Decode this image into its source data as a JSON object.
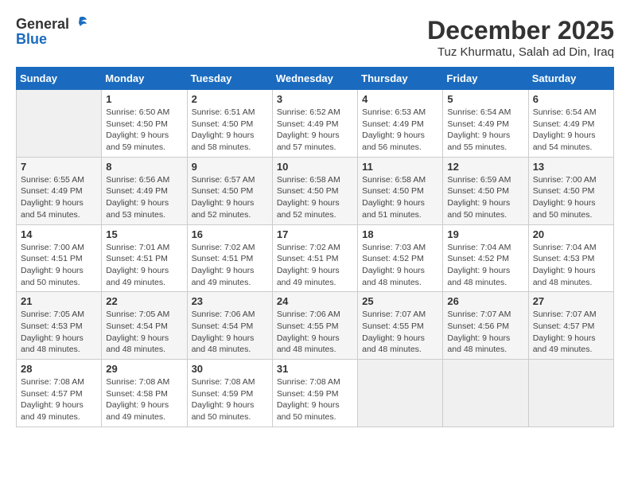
{
  "header": {
    "logo_general": "General",
    "logo_blue": "Blue",
    "month_title": "December 2025",
    "location": "Tuz Khurmatu, Salah ad Din, Iraq"
  },
  "days_of_week": [
    "Sunday",
    "Monday",
    "Tuesday",
    "Wednesday",
    "Thursday",
    "Friday",
    "Saturday"
  ],
  "weeks": [
    [
      {
        "day": "",
        "info": ""
      },
      {
        "day": "1",
        "info": "Sunrise: 6:50 AM\nSunset: 4:50 PM\nDaylight: 9 hours\nand 59 minutes."
      },
      {
        "day": "2",
        "info": "Sunrise: 6:51 AM\nSunset: 4:50 PM\nDaylight: 9 hours\nand 58 minutes."
      },
      {
        "day": "3",
        "info": "Sunrise: 6:52 AM\nSunset: 4:49 PM\nDaylight: 9 hours\nand 57 minutes."
      },
      {
        "day": "4",
        "info": "Sunrise: 6:53 AM\nSunset: 4:49 PM\nDaylight: 9 hours\nand 56 minutes."
      },
      {
        "day": "5",
        "info": "Sunrise: 6:54 AM\nSunset: 4:49 PM\nDaylight: 9 hours\nand 55 minutes."
      },
      {
        "day": "6",
        "info": "Sunrise: 6:54 AM\nSunset: 4:49 PM\nDaylight: 9 hours\nand 54 minutes."
      }
    ],
    [
      {
        "day": "7",
        "info": "Sunrise: 6:55 AM\nSunset: 4:49 PM\nDaylight: 9 hours\nand 54 minutes."
      },
      {
        "day": "8",
        "info": "Sunrise: 6:56 AM\nSunset: 4:49 PM\nDaylight: 9 hours\nand 53 minutes."
      },
      {
        "day": "9",
        "info": "Sunrise: 6:57 AM\nSunset: 4:50 PM\nDaylight: 9 hours\nand 52 minutes."
      },
      {
        "day": "10",
        "info": "Sunrise: 6:58 AM\nSunset: 4:50 PM\nDaylight: 9 hours\nand 52 minutes."
      },
      {
        "day": "11",
        "info": "Sunrise: 6:58 AM\nSunset: 4:50 PM\nDaylight: 9 hours\nand 51 minutes."
      },
      {
        "day": "12",
        "info": "Sunrise: 6:59 AM\nSunset: 4:50 PM\nDaylight: 9 hours\nand 50 minutes."
      },
      {
        "day": "13",
        "info": "Sunrise: 7:00 AM\nSunset: 4:50 PM\nDaylight: 9 hours\nand 50 minutes."
      }
    ],
    [
      {
        "day": "14",
        "info": "Sunrise: 7:00 AM\nSunset: 4:51 PM\nDaylight: 9 hours\nand 50 minutes."
      },
      {
        "day": "15",
        "info": "Sunrise: 7:01 AM\nSunset: 4:51 PM\nDaylight: 9 hours\nand 49 minutes."
      },
      {
        "day": "16",
        "info": "Sunrise: 7:02 AM\nSunset: 4:51 PM\nDaylight: 9 hours\nand 49 minutes."
      },
      {
        "day": "17",
        "info": "Sunrise: 7:02 AM\nSunset: 4:51 PM\nDaylight: 9 hours\nand 49 minutes."
      },
      {
        "day": "18",
        "info": "Sunrise: 7:03 AM\nSunset: 4:52 PM\nDaylight: 9 hours\nand 48 minutes."
      },
      {
        "day": "19",
        "info": "Sunrise: 7:04 AM\nSunset: 4:52 PM\nDaylight: 9 hours\nand 48 minutes."
      },
      {
        "day": "20",
        "info": "Sunrise: 7:04 AM\nSunset: 4:53 PM\nDaylight: 9 hours\nand 48 minutes."
      }
    ],
    [
      {
        "day": "21",
        "info": "Sunrise: 7:05 AM\nSunset: 4:53 PM\nDaylight: 9 hours\nand 48 minutes."
      },
      {
        "day": "22",
        "info": "Sunrise: 7:05 AM\nSunset: 4:54 PM\nDaylight: 9 hours\nand 48 minutes."
      },
      {
        "day": "23",
        "info": "Sunrise: 7:06 AM\nSunset: 4:54 PM\nDaylight: 9 hours\nand 48 minutes."
      },
      {
        "day": "24",
        "info": "Sunrise: 7:06 AM\nSunset: 4:55 PM\nDaylight: 9 hours\nand 48 minutes."
      },
      {
        "day": "25",
        "info": "Sunrise: 7:07 AM\nSunset: 4:55 PM\nDaylight: 9 hours\nand 48 minutes."
      },
      {
        "day": "26",
        "info": "Sunrise: 7:07 AM\nSunset: 4:56 PM\nDaylight: 9 hours\nand 48 minutes."
      },
      {
        "day": "27",
        "info": "Sunrise: 7:07 AM\nSunset: 4:57 PM\nDaylight: 9 hours\nand 49 minutes."
      }
    ],
    [
      {
        "day": "28",
        "info": "Sunrise: 7:08 AM\nSunset: 4:57 PM\nDaylight: 9 hours\nand 49 minutes."
      },
      {
        "day": "29",
        "info": "Sunrise: 7:08 AM\nSunset: 4:58 PM\nDaylight: 9 hours\nand 49 minutes."
      },
      {
        "day": "30",
        "info": "Sunrise: 7:08 AM\nSunset: 4:59 PM\nDaylight: 9 hours\nand 50 minutes."
      },
      {
        "day": "31",
        "info": "Sunrise: 7:08 AM\nSunset: 4:59 PM\nDaylight: 9 hours\nand 50 minutes."
      },
      {
        "day": "",
        "info": ""
      },
      {
        "day": "",
        "info": ""
      },
      {
        "day": "",
        "info": ""
      }
    ]
  ]
}
